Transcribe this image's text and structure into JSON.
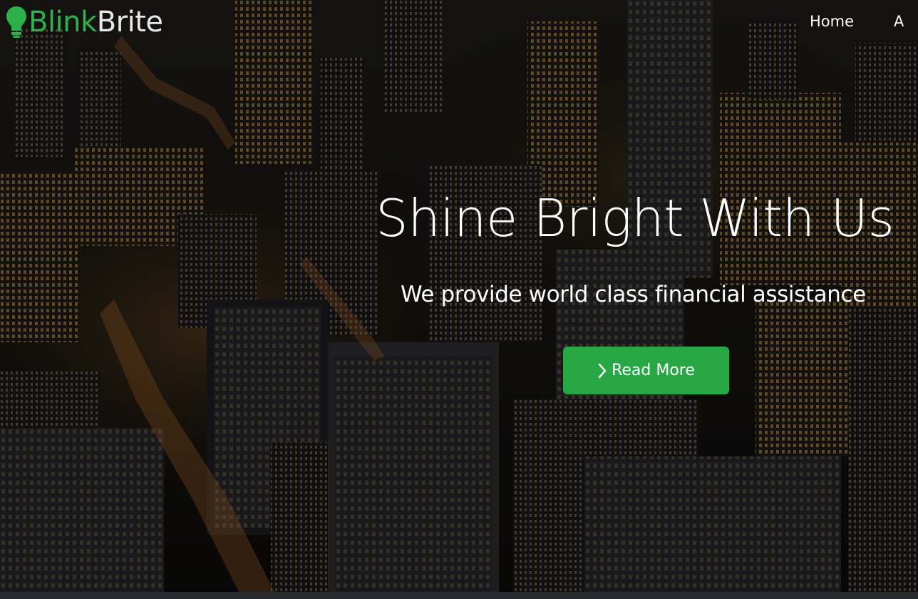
{
  "brand": {
    "name_part1": "Blink",
    "name_part2": "Brite",
    "icon": "lightbulb-icon",
    "primary_color": "#2bb14a"
  },
  "nav": {
    "items": [
      {
        "label": "Home"
      },
      {
        "label": "A"
      }
    ]
  },
  "hero": {
    "title": "Shine Bright With Us",
    "subtitle": "We provide world class financial assistance",
    "cta": {
      "label": "Read More",
      "icon": "chevron-right-icon",
      "color": "#28a745"
    },
    "background": "night-city-aerial-photo"
  }
}
